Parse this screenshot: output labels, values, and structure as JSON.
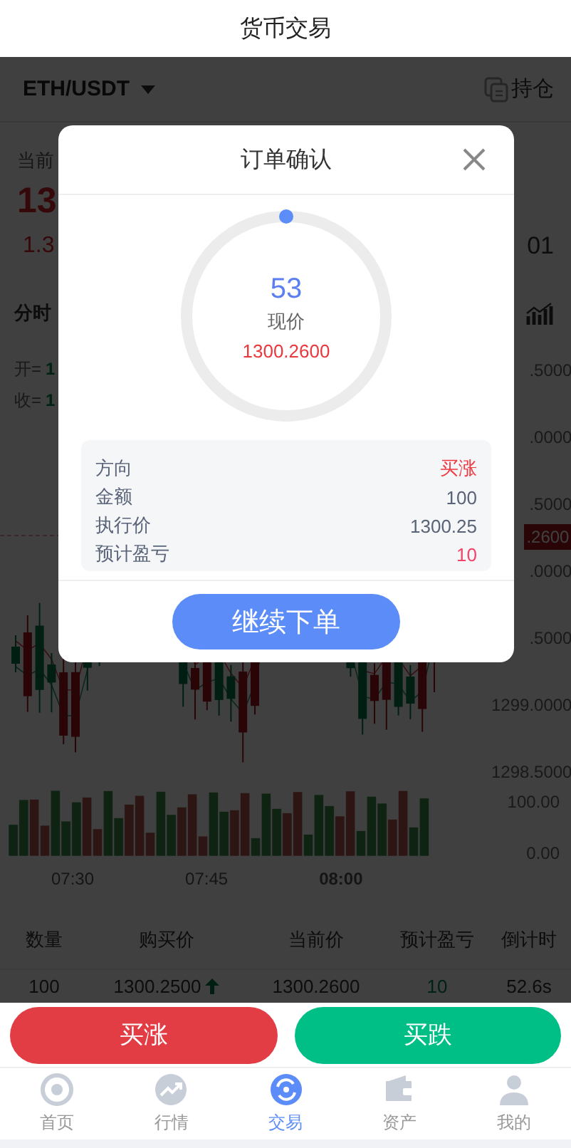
{
  "header": {
    "title": "货币交易"
  },
  "pair": {
    "symbol": "ETH/USDT",
    "positions_label": "持仓"
  },
  "price_panel": {
    "label": "当前",
    "price": "13",
    "change": "1.3",
    "right_value": "01"
  },
  "chart": {
    "tab": "分时",
    "legend": [
      {
        "label": "开=",
        "value": "1"
      },
      {
        "label": "收=",
        "value": "1"
      }
    ],
    "price_axis": [
      {
        "text": ".5000",
        "kind": "label"
      },
      {
        "text": ".0000",
        "kind": "label"
      },
      {
        "text": ".5000",
        "kind": "label"
      },
      {
        "text": ".2600",
        "kind": "tag"
      },
      {
        "text": ".0000",
        "kind": "label"
      },
      {
        "text": ".5000",
        "kind": "label"
      },
      {
        "text": "1299.0000",
        "kind": "label"
      },
      {
        "text": "1298.5000",
        "kind": "label"
      }
    ],
    "volume_axis": [
      "100.00",
      "0.00"
    ],
    "time_axis": [
      {
        "text": "07:30",
        "bold": false
      },
      {
        "text": "07:45",
        "bold": false
      },
      {
        "text": "08:00",
        "bold": true
      }
    ]
  },
  "table": {
    "columns": [
      "数量",
      "购买价",
      "当前价",
      "预计盈亏",
      "倒计时"
    ],
    "rows": [
      {
        "cells": [
          "100",
          "1300.2500",
          "1300.2600",
          "10",
          "52.6s"
        ],
        "rising": true
      }
    ]
  },
  "modal": {
    "title": "订单确认",
    "countdown": "53",
    "price_label": "现价",
    "price": "1300.2600",
    "details": [
      {
        "label": "方向",
        "value": "买涨",
        "color": "#f0393f"
      },
      {
        "label": "金额",
        "value": "100",
        "color": "#5a6478"
      },
      {
        "label": "执行价",
        "value": "1300.25",
        "color": "#5a6478"
      },
      {
        "label": "预计盈亏",
        "value": "10",
        "color": "#f0456a"
      }
    ],
    "confirm": "继续下单"
  },
  "actions": [
    {
      "label": "买涨",
      "kind": "up"
    },
    {
      "label": "买跌",
      "kind": "down"
    }
  ],
  "tabbar": [
    {
      "label": "首页",
      "kind": "home",
      "selected": false
    },
    {
      "label": "行情",
      "kind": "market",
      "selected": false
    },
    {
      "label": "交易",
      "kind": "trade",
      "selected": true
    },
    {
      "label": "资产",
      "kind": "assets",
      "selected": false
    },
    {
      "label": "我的",
      "kind": "mine",
      "selected": false
    }
  ]
}
